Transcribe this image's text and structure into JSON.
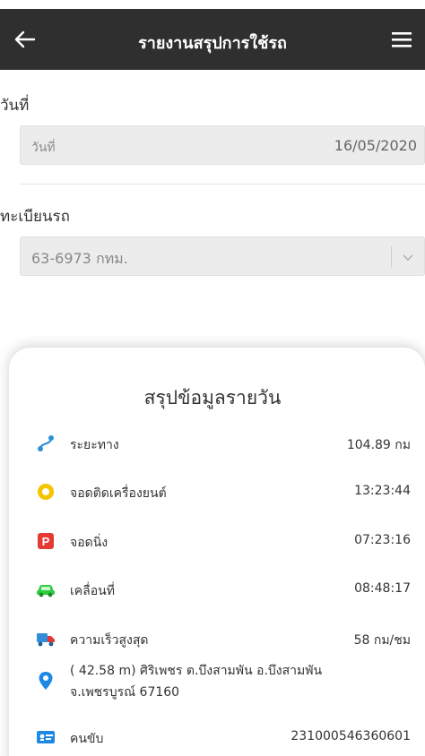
{
  "header": {
    "title": "รายงานสรุปการใช้รถ",
    "back_icon": "arrow-left-icon",
    "menu_icon": "hamburger-menu-icon"
  },
  "form": {
    "date_label": "วันที่",
    "date_placeholder": "วันที่",
    "date_value": "16/05/2020",
    "plate_label": "ทะเบียนรถ",
    "plate_value": "63-6973 กทม."
  },
  "summary": {
    "title": "สรุปข้อมูลรายวัน",
    "rows": [
      {
        "label": "ระยะทาง",
        "value": "104.89 กม",
        "icon": "route-icon"
      },
      {
        "label": "จอดติดเครื่องยนต์",
        "value": "13:23:44",
        "icon": "idle-engine-icon"
      },
      {
        "label": "จอดนิ่ง",
        "value": "07:23:16",
        "icon": "parking-icon"
      },
      {
        "label": "เคลื่อนที่",
        "value": "08:48:17",
        "icon": "car-moving-icon"
      },
      {
        "label": "ความเร็วสูงสุด",
        "value": "58 กม/ชม",
        "icon": "truck-speed-icon"
      }
    ],
    "location_line1": "( 42.58 m) ศิริเพชร ต.บึงสามพัน อ.บึงสามพัน",
    "location_line2": "จ.เพชรบูรณ์ 67160",
    "location_icon": "map-pin-icon",
    "driver_label": "คนขับ",
    "driver_value": "231000546360601",
    "driver_icon": "id-card-icon"
  },
  "colors": {
    "appbar": "#2f2f2f",
    "route": "#2f8fd8",
    "idle": "#f5c400",
    "parking": "#e53935",
    "moving": "#2ecc40",
    "pin": "#1e88e5"
  }
}
